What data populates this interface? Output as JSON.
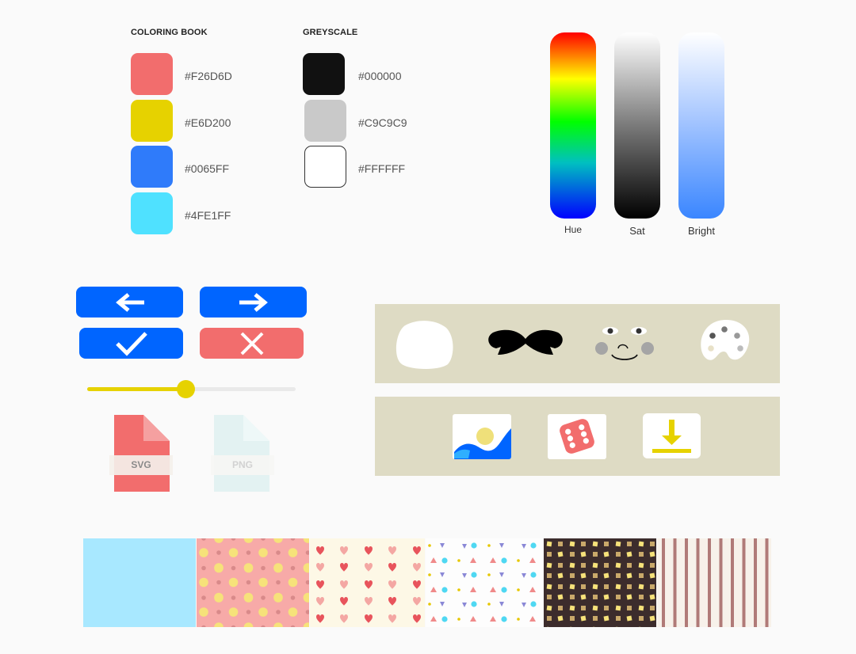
{
  "palettes": [
    {
      "title": "COLORING BOOK",
      "swatches": [
        {
          "hex": "#F26D6D",
          "color": "#F26D6D"
        },
        {
          "hex": "#E6D200",
          "color": "#E6D200"
        },
        {
          "hex": "#0065FF",
          "color": "#2F7BFA"
        },
        {
          "hex": "#4FE1FF",
          "color": "#4FE1FF"
        }
      ]
    },
    {
      "title": "GREYSCALE",
      "swatches": [
        {
          "hex": "#000000",
          "color": "#111111"
        },
        {
          "hex": "#C9C9C9",
          "color": "#C9C9C9"
        },
        {
          "hex": "#FFFFFF",
          "color": "#FFFFFF"
        }
      ]
    }
  ],
  "color_bars": {
    "hue_label": "Hue",
    "sat_label": "Sat",
    "bright_label": "Bright"
  },
  "controls": {
    "back_icon": "arrow-left-icon",
    "forward_icon": "arrow-right-icon",
    "confirm_icon": "checkmark-icon",
    "cancel_icon": "close-icon",
    "primary_color": "#0065FF",
    "cancel_color": "#F26D6D",
    "slider_value": 0.47,
    "slider_color": "#E6D200"
  },
  "files": {
    "svg_label": "SVG",
    "png_label": "PNG"
  },
  "panels": {
    "shapes": [
      "blob-icon",
      "mustache-icon",
      "face-icon",
      "palette-icon"
    ],
    "actions": [
      "image-icon",
      "dice-icon",
      "download-icon"
    ],
    "background": "#DEDBC4"
  },
  "patterns": [
    "solid-cyan",
    "dots-pink",
    "hearts-cream",
    "confetti-white",
    "squares-dark",
    "stripes"
  ]
}
